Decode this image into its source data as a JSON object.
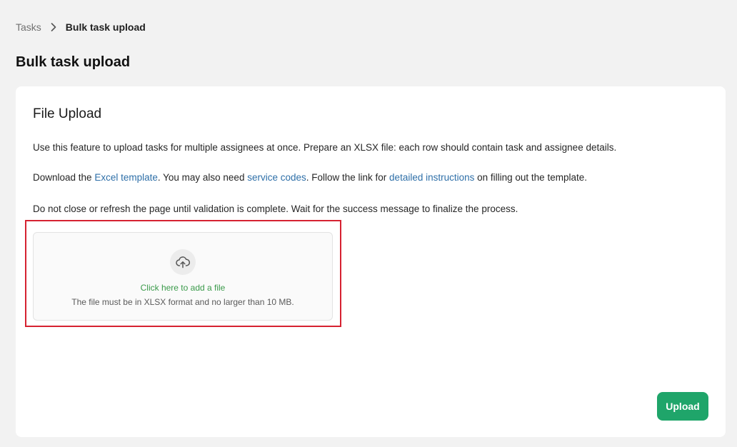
{
  "breadcrumb": {
    "parent": "Tasks",
    "current": "Bulk task upload"
  },
  "page": {
    "title": "Bulk task upload"
  },
  "card": {
    "title": "File Upload",
    "intro": "Use this feature to upload tasks for multiple assignees at once. Prepare an XLSX file: each row should contain task and assignee details.",
    "download": {
      "prefix": "Download the ",
      "template_link": "Excel template",
      "middle1": ". You may also need ",
      "service_codes_link": "service codes",
      "middle2": ". Follow the link for ",
      "instructions_link": "detailed instructions",
      "suffix": " on filling out the template."
    },
    "warning": "Do not close or refresh the page until validation is complete. Wait for the success message to finalize the process."
  },
  "dropzone": {
    "cta": "Click here to add a file",
    "hint": "The file must be in XLSX format and no larger than 10 MB.",
    "icon": "cloud-upload-icon"
  },
  "actions": {
    "upload_label": "Upload"
  },
  "colors": {
    "link": "#2e6fa8",
    "accent_green": "#1fa56a",
    "cta_green": "#3a9a4a",
    "highlight_red": "#d62231",
    "background": "#f2f2f2"
  }
}
